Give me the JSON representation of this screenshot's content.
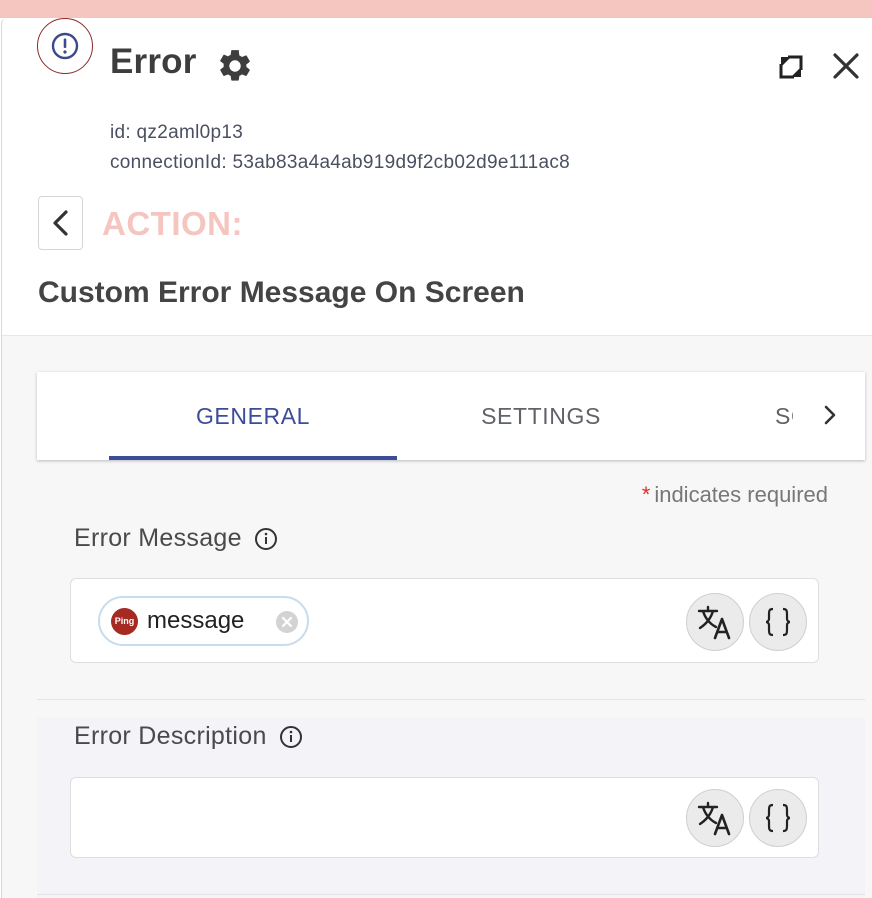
{
  "header": {
    "title": "Error",
    "id_line": "id: qz2aml0p13",
    "connection_line": "connectionId: 53ab83a4a4ab919d9f2cb02d9e111ac8"
  },
  "action": {
    "label": "ACTION:",
    "name": "Custom Error Message On Screen"
  },
  "tabs": {
    "general": "GENERAL",
    "settings": "SETTINGS",
    "third": "SCHEMA"
  },
  "form": {
    "required_note": "indicates required",
    "required_star": "*",
    "error_message_label": "Error Message",
    "error_description_label": "Error Description",
    "chip_badge": "Ping",
    "chip_text": "message"
  },
  "colors": {
    "accent": "#3d4c99",
    "brand_red": "#a52a22",
    "action_pink": "#f5c5c0",
    "required_red": "#d82e2e"
  },
  "icons": [
    "error-circle-icon",
    "gear-icon",
    "expand-icon",
    "close-icon",
    "chevron-left-icon",
    "chevron-right-icon",
    "info-icon",
    "translate-icon",
    "curly-braces-icon",
    "remove-chip-icon"
  ]
}
